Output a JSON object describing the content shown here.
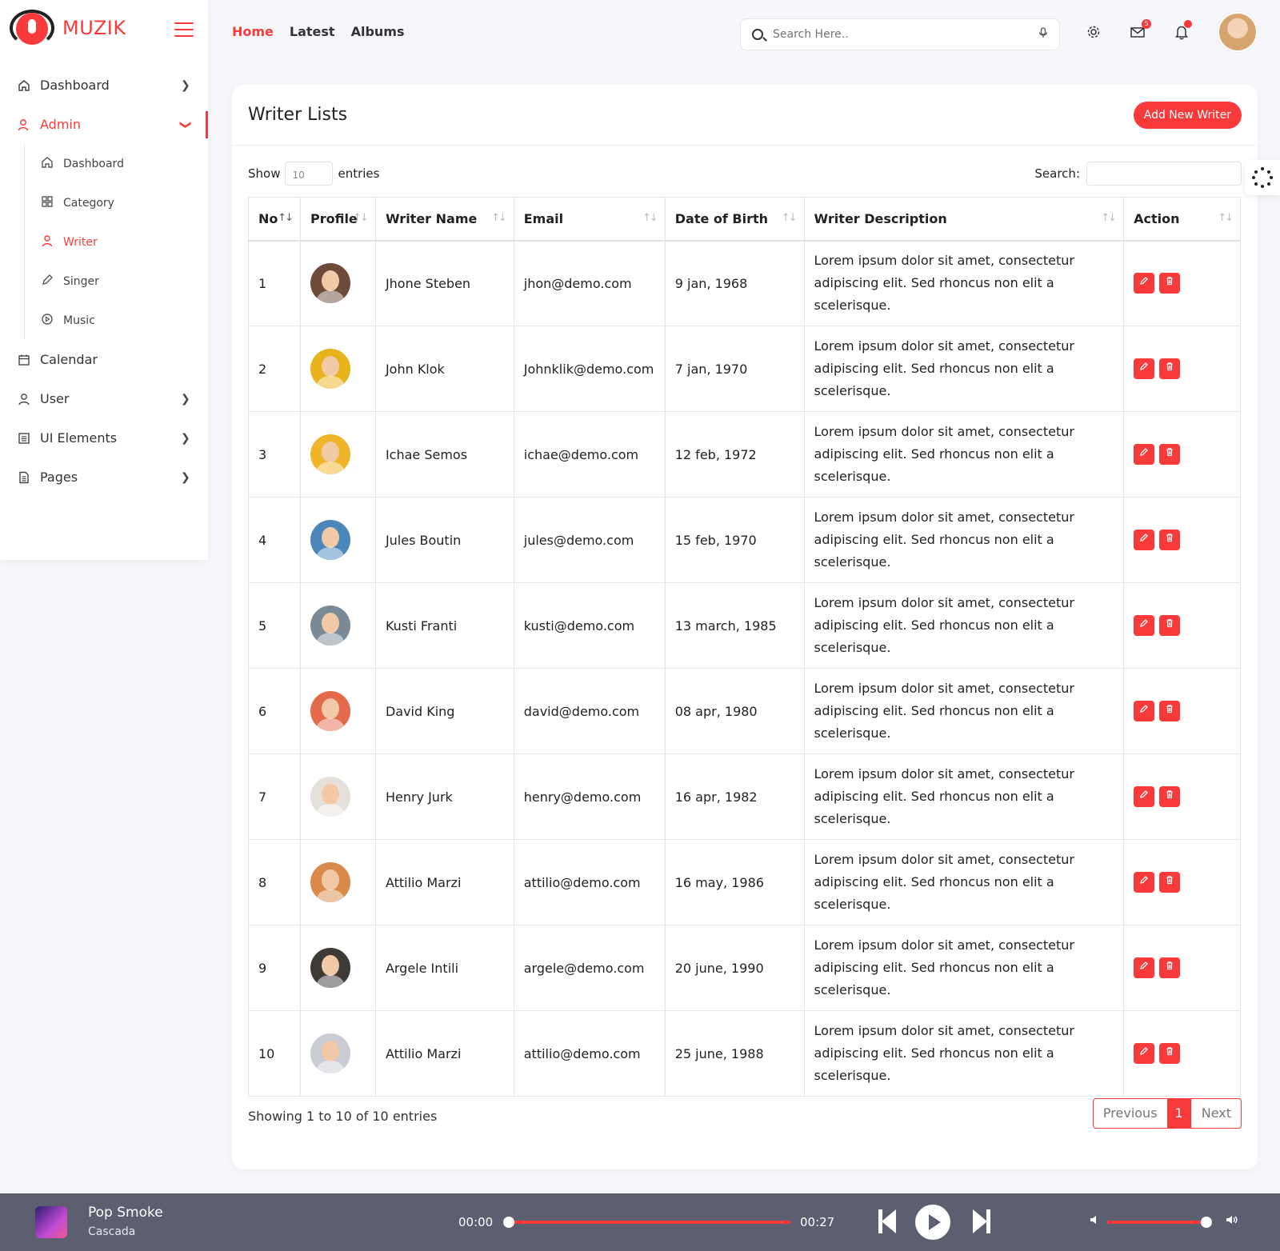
{
  "brand": {
    "name": "MUZIK"
  },
  "sidebar": {
    "items": [
      {
        "label": "Dashboard",
        "icon": "home-icon",
        "has_chevron": true
      },
      {
        "label": "Admin",
        "icon": "user-icon",
        "active": true
      },
      {
        "label": "Calendar",
        "icon": "calendar-icon"
      },
      {
        "label": "User",
        "icon": "user-icon",
        "has_chevron": true
      },
      {
        "label": "UI Elements",
        "icon": "list-icon",
        "has_chevron": true
      },
      {
        "label": "Pages",
        "icon": "page-icon",
        "has_chevron": true
      }
    ],
    "admin_sub": [
      {
        "label": "Dashboard",
        "icon": "home-icon"
      },
      {
        "label": "Category",
        "icon": "grid-icon"
      },
      {
        "label": "Writer",
        "icon": "user-icon",
        "active": true
      },
      {
        "label": "Singer",
        "icon": "pen-icon"
      },
      {
        "label": "Music",
        "icon": "play-circle-icon"
      }
    ]
  },
  "topnav": {
    "home": "Home",
    "latest": "Latest",
    "albums": "Albums"
  },
  "search": {
    "placeholder": "Search Here.."
  },
  "notifications": {
    "mail_badge": "5"
  },
  "card": {
    "title": "Writer Lists",
    "add_button": "Add New Writer",
    "show_label": "Show",
    "entries_value": "10",
    "entries_label": "entries",
    "search_label": "Search:"
  },
  "table": {
    "headers": [
      "No",
      "Profile",
      "Writer Name",
      "Email",
      "Date of Birth",
      "Writer Description",
      "Action"
    ],
    "rows": [
      {
        "no": "1",
        "name": "Jhone Steben",
        "email": "jhon@demo.com",
        "dob": "9 jan, 1968",
        "desc": "Lorem ipsum dolor sit amet, consectetur adipiscing elit. Sed rhoncus non elit a scelerisque.",
        "avatar_color": "#6d4a3a"
      },
      {
        "no": "2",
        "name": "John Klok",
        "email": "Johnklik@demo.com",
        "dob": "7 jan, 1970",
        "desc": "Lorem ipsum dolor sit amet, consectetur adipiscing elit. Sed rhoncus non elit a scelerisque.",
        "avatar_color": "#e8b21c"
      },
      {
        "no": "3",
        "name": "Ichae Semos",
        "email": "ichae@demo.com",
        "dob": "12 feb, 1972",
        "desc": "Lorem ipsum dolor sit amet, consectetur adipiscing elit. Sed rhoncus non elit a scelerisque.",
        "avatar_color": "#f0b428"
      },
      {
        "no": "4",
        "name": "Jules Boutin",
        "email": "jules@demo.com",
        "dob": "15 feb, 1970",
        "desc": "Lorem ipsum dolor sit amet, consectetur adipiscing elit. Sed rhoncus non elit a scelerisque.",
        "avatar_color": "#4a86b8"
      },
      {
        "no": "5",
        "name": "Kusti Franti",
        "email": "kusti@demo.com",
        "dob": "13 march, 1985",
        "desc": "Lorem ipsum dolor sit amet, consectetur adipiscing elit. Sed rhoncus non elit a scelerisque.",
        "avatar_color": "#7a8a96"
      },
      {
        "no": "6",
        "name": "David King",
        "email": "david@demo.com",
        "dob": "08 apr, 1980",
        "desc": "Lorem ipsum dolor sit amet, consectetur adipiscing elit. Sed rhoncus non elit a scelerisque.",
        "avatar_color": "#e46a4c"
      },
      {
        "no": "7",
        "name": "Henry Jurk",
        "email": "henry@demo.com",
        "dob": "16 apr, 1982",
        "desc": "Lorem ipsum dolor sit amet, consectetur adipiscing elit. Sed rhoncus non elit a scelerisque.",
        "avatar_color": "#e6e0da"
      },
      {
        "no": "8",
        "name": "Attilio Marzi",
        "email": "attilio@demo.com",
        "dob": "16 may, 1986",
        "desc": "Lorem ipsum dolor sit amet, consectetur adipiscing elit. Sed rhoncus non elit a scelerisque.",
        "avatar_color": "#d98a4a"
      },
      {
        "no": "9",
        "name": "Argele Intili",
        "email": "argele@demo.com",
        "dob": "20 june, 1990",
        "desc": "Lorem ipsum dolor sit amet, consectetur adipiscing elit. Sed rhoncus non elit a scelerisque.",
        "avatar_color": "#3e3a36"
      },
      {
        "no": "10",
        "name": "Attilio Marzi",
        "email": "attilio@demo.com",
        "dob": "25 june, 1988",
        "desc": "Lorem ipsum dolor sit amet, consectetur adipiscing elit. Sed rhoncus non elit a scelerisque.",
        "avatar_color": "#c9ccd2"
      }
    ]
  },
  "footer": {
    "info": "Showing 1 to 10 of 10 entries",
    "prev": "Previous",
    "page": "1",
    "next": "Next"
  },
  "player": {
    "song": "Pop Smoke",
    "artist": "Cascada",
    "time_start": "00:00",
    "time_end": "00:27",
    "progress": 0.0,
    "volume": 0.95
  },
  "colors": {
    "accent": "#f93a3a",
    "player_bg": "#5c5f70"
  }
}
